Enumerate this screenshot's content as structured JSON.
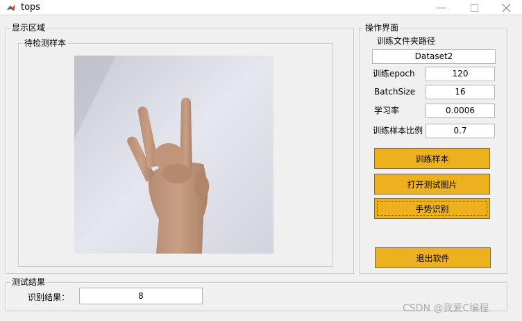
{
  "window": {
    "title": "tops"
  },
  "display_area": {
    "title": "显示区域",
    "sample_panel_title": "待检测样本"
  },
  "operation": {
    "title": "操作界面",
    "path_label": "训练文件夹路径",
    "path_value": "Dataset2",
    "epoch_label": "训练epoch",
    "epoch_value": "120",
    "batch_label": "BatchSize",
    "batch_value": "16",
    "lr_label": "学习率",
    "lr_value": "0.0006",
    "ratio_label": "训练样本比例",
    "ratio_value": "0.7",
    "buttons": {
      "train": "训练样本",
      "open_image": "打开测试图片",
      "recognize": "手势识别",
      "exit": "退出软件"
    }
  },
  "results": {
    "title": "测试结果",
    "result_label": "识别结果：",
    "result_value": "8"
  },
  "watermark": "CSDN @我爱C编程",
  "colors": {
    "button": "#edb120",
    "background": "#f0f0f0"
  }
}
